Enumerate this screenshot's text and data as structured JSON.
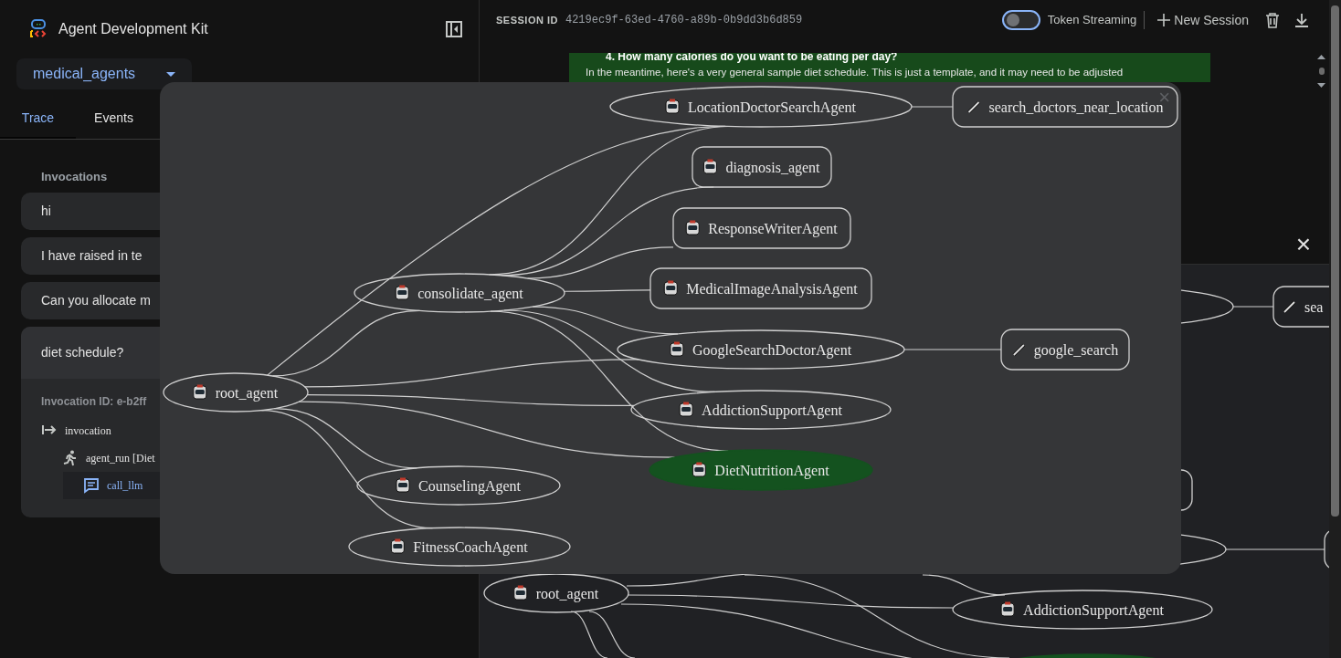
{
  "sidebar": {
    "title": "Agent Development Kit",
    "app_select": "medical_agents",
    "tabs": [
      {
        "label": "Trace",
        "selected": true
      },
      {
        "label": "Events",
        "selected": false
      }
    ],
    "section_title": "Invocations",
    "invocations": [
      {
        "text": "hi",
        "expanded": false
      },
      {
        "text": "I have raised in te",
        "expanded": false
      },
      {
        "text": "Can you allocate m",
        "expanded": false
      },
      {
        "text": "diet schedule?",
        "expanded": true,
        "invocation_id": "Invocation ID: e-b2ff",
        "spans": [
          {
            "label": "invocation",
            "kind": "invocation",
            "selected": false,
            "children": [
              {
                "label": "agent_run [Diet",
                "kind": "agent_run",
                "selected": false,
                "children": [
                  {
                    "label": "call_llm",
                    "kind": "llm",
                    "selected": true
                  }
                ]
              }
            ]
          }
        ]
      }
    ]
  },
  "topbar": {
    "session_label": "SESSION ID",
    "session_id": "4219ec9f-63ed-4760-a89b-0b9dd3b6d859",
    "token_streaming": {
      "label": "Token Streaming",
      "on": false
    },
    "new_session": "New Session"
  },
  "chat": {
    "lines": [
      "4. How many calories do you want to be eating per day?",
      "In the meantime, here's a very general sample diet schedule. This is just a template, and it may need to be adjusted"
    ]
  },
  "trace_panel": {
    "close": "×",
    "graph_fragments": [
      {
        "kind": "agent",
        "selected": false
      },
      {
        "kind": "tool",
        "label": "sea",
        "selected": false
      },
      {
        "kind": "box",
        "selected": false
      },
      {
        "kind": "agent",
        "selected": false
      },
      {
        "kind": "tool",
        "selected": false
      },
      {
        "kind": "agent",
        "label": "root_agent",
        "selected": false
      },
      {
        "kind": "agent",
        "label": "AddictionSupportAgent",
        "selected": false
      },
      {
        "kind": "agent",
        "selected": true
      }
    ]
  },
  "graph_dialog": {
    "close": "×",
    "root": {
      "label": "root_agent",
      "kind": "agent",
      "selected": false,
      "children": [
        {
          "label": "consolidate_agent",
          "kind": "agent",
          "selected": false,
          "children": [
            {
              "label": "LocationDoctorSearchAgent",
              "kind": "agent",
              "selected": false,
              "root_link": true,
              "children": [
                {
                  "label": "search_doctors_near_location",
                  "kind": "tool",
                  "selected": false
                }
              ]
            },
            {
              "label": "diagnosis_agent",
              "kind": "box",
              "selected": false,
              "root_link": false
            },
            {
              "label": "ResponseWriterAgent",
              "kind": "box",
              "selected": false,
              "root_link": false
            },
            {
              "label": "MedicalImageAnalysisAgent",
              "kind": "box",
              "selected": false,
              "root_link": false
            },
            {
              "label": "GoogleSearchDoctorAgent",
              "kind": "agent",
              "selected": false,
              "root_link": true,
              "children": [
                {
                  "label": "google_search",
                  "kind": "tool",
                  "selected": false
                }
              ]
            },
            {
              "label": "AddictionSupportAgent",
              "kind": "agent",
              "selected": false,
              "root_link": true
            },
            {
              "label": "DietNutritionAgent",
              "kind": "agent",
              "selected": true,
              "root_link": true
            }
          ]
        },
        {
          "label": "CounselingAgent",
          "kind": "agent",
          "selected": false
        },
        {
          "label": "FitnessCoachAgent",
          "kind": "agent",
          "selected": false
        }
      ]
    }
  }
}
